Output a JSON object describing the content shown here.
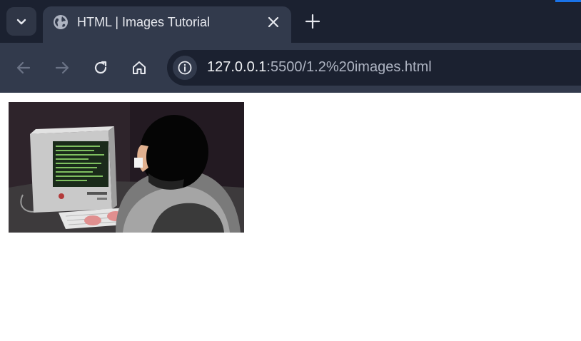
{
  "tab": {
    "title": "HTML | Images Tutorial",
    "favicon": "globe-icon"
  },
  "tabstrip": {
    "search_icon": "chevron-down-icon",
    "close_icon": "close-icon",
    "new_tab_icon": "plus-icon"
  },
  "toolbar": {
    "back_icon": "arrow-left-icon",
    "forward_icon": "arrow-right-icon",
    "reload_icon": "reload-icon",
    "home_icon": "home-icon",
    "site_info_icon": "info-icon"
  },
  "address_bar": {
    "host": "127.0.0.1",
    "path": ":5500/1.2%20images.html"
  },
  "page": {
    "image_description": "Animated cartoon of a hacker typing at a retro computer with green code on the monitor"
  },
  "colors": {
    "tabstrip_bg": "#1b2130",
    "toolbar_bg": "#323a4c",
    "omnibox_bg": "#1b2130",
    "accent": "#1a73e8",
    "page_bg": "#ffffff"
  }
}
